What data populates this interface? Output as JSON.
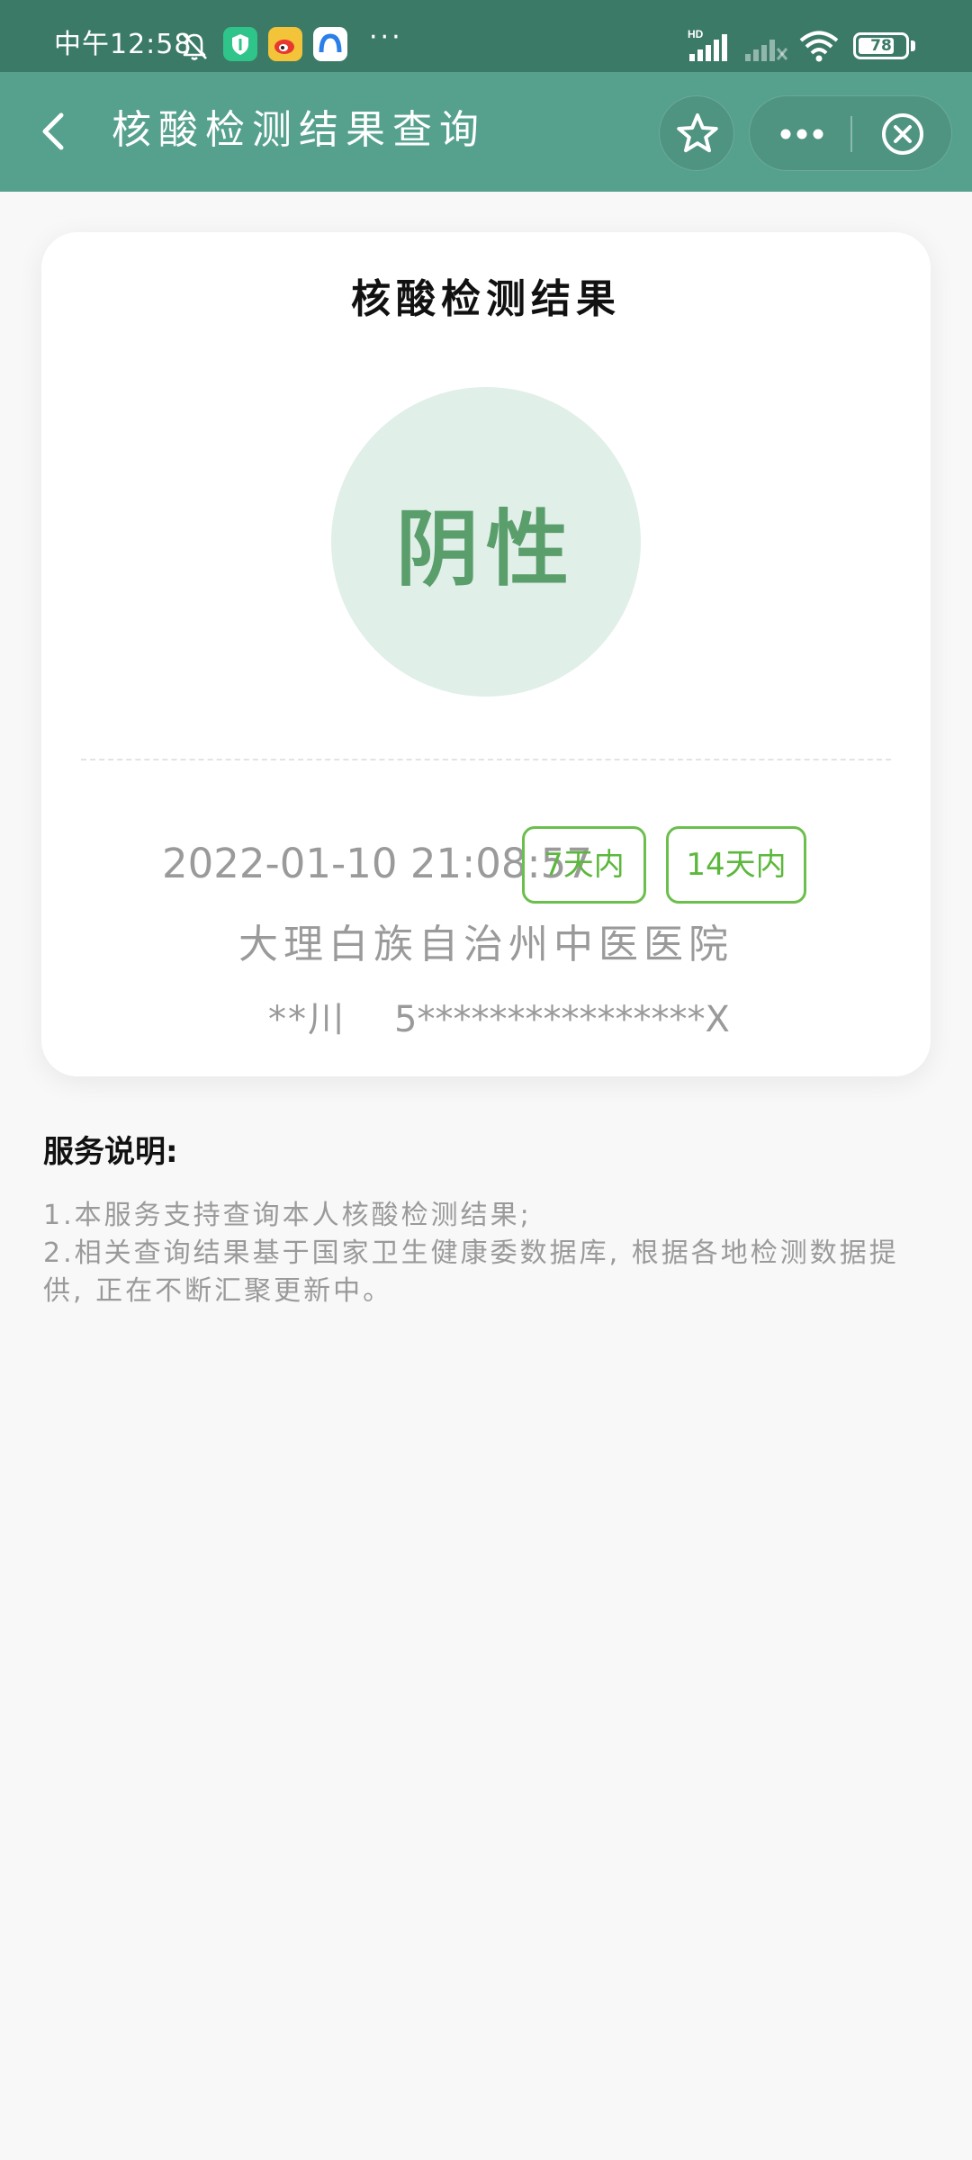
{
  "status_bar": {
    "time": "中午12:58",
    "network": "HD",
    "battery": "78",
    "battery_percent": 78,
    "more_indicator": "···",
    "icons": [
      "bell-off-icon",
      "shield-app-icon",
      "weibo-app-icon",
      "browser-app-icon",
      "signal-icon",
      "signal-no-sim-icon",
      "wifi-icon",
      "battery-icon"
    ]
  },
  "header": {
    "title": "核酸检测结果查询",
    "icons": [
      "back-chevron-icon",
      "star-icon",
      "more-dots-icon",
      "close-circle-icon"
    ]
  },
  "result_card": {
    "title": "核酸检测结果",
    "result": "阴性",
    "test_time": "2022-01-10 21:08:57",
    "badges": [
      "7天内",
      "14天内"
    ],
    "hospital": "大理白族自治州中医医院",
    "name": "**川",
    "id_number": "5****************X"
  },
  "notes": {
    "title": "服务说明:",
    "lines": [
      "1.本服务支持查询本人核酸检测结果;",
      "2.相关查询结果基于国家卫生健康委数据库, 根据各地检测数据提供, 正在不断汇聚更新中。"
    ]
  },
  "colors": {
    "status_bar": "#3b7a67",
    "header": "#55a18d",
    "result_circle": "#e0efe8",
    "result_text": "#5a9e6c",
    "badge": "#5cb83c"
  }
}
